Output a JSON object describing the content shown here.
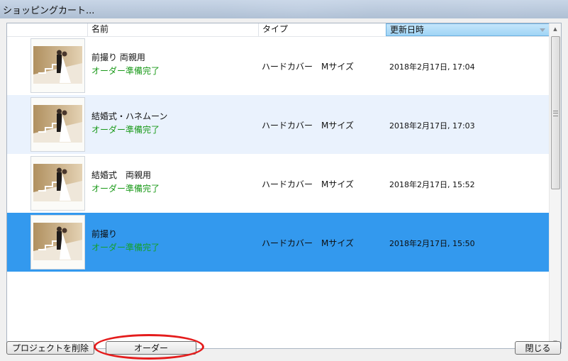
{
  "window": {
    "title": "ショッピングカート..."
  },
  "columns": {
    "name": "名前",
    "type": "タイプ",
    "updated": "更新日時"
  },
  "rows": [
    {
      "name": "前撮り 両親用",
      "status": "オーダー準備完了",
      "type": "ハードカバー　Mサイズ",
      "date": "2018年2月17日, 17:04"
    },
    {
      "name": "結婚式・ハネムーン",
      "status": "オーダー準備完了",
      "type": "ハードカバー　Mサイズ",
      "date": "2018年2月17日, 17:03"
    },
    {
      "name": "結婚式　両親用",
      "status": "オーダー準備完了",
      "type": "ハードカバー　Mサイズ",
      "date": "2018年2月17日, 15:52"
    },
    {
      "name": "前撮り",
      "status": "オーダー準備完了",
      "type": "ハードカバー　Mサイズ",
      "date": "2018年2月17日, 15:50"
    }
  ],
  "buttons": {
    "delete": "プロジェクトを削除",
    "order": "オーダー",
    "close": "閉じる"
  },
  "colors": {
    "selected_row": "#3399ee",
    "alt_row": "#eaf2fd",
    "status_text": "#1a9a1a",
    "annotation": "#e41c1c"
  }
}
